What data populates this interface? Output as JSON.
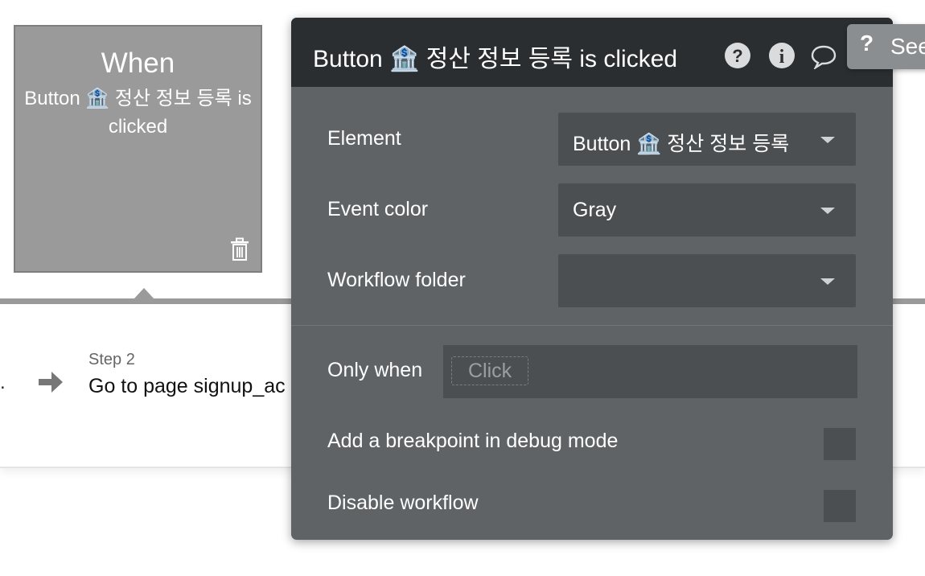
{
  "event_card": {
    "heading": "When",
    "description": "Button 🏦 정산 정보 등록 is clicked"
  },
  "workflow": {
    "prev_step_fragment": ".",
    "step_label": "Step 2",
    "step_description": "Go to page signup_ac"
  },
  "panel": {
    "title": "Button 🏦 정산 정보 등록 is clicked",
    "header_icons": [
      "help-circle-icon",
      "info-icon",
      "comment-icon"
    ],
    "rows": {
      "element": {
        "label": "Element",
        "value": "Button 🏦 정산 정보 등록"
      },
      "event_color": {
        "label": "Event color",
        "value": "Gray"
      },
      "workflow_folder": {
        "label": "Workflow folder",
        "value": ""
      }
    },
    "only_when": {
      "label": "Only when",
      "placeholder": "Click"
    },
    "breakpoint": {
      "label": "Add a breakpoint in debug mode",
      "checked": false
    },
    "disable": {
      "label": "Disable workflow",
      "checked": false
    }
  },
  "see_tab": {
    "icon": "?",
    "label": "See"
  },
  "colors": {
    "panel_bg": "#5f6366",
    "panel_header": "#2b2e30",
    "card_gray": "#9a9a9a",
    "field_bg": "#4c4f52"
  }
}
